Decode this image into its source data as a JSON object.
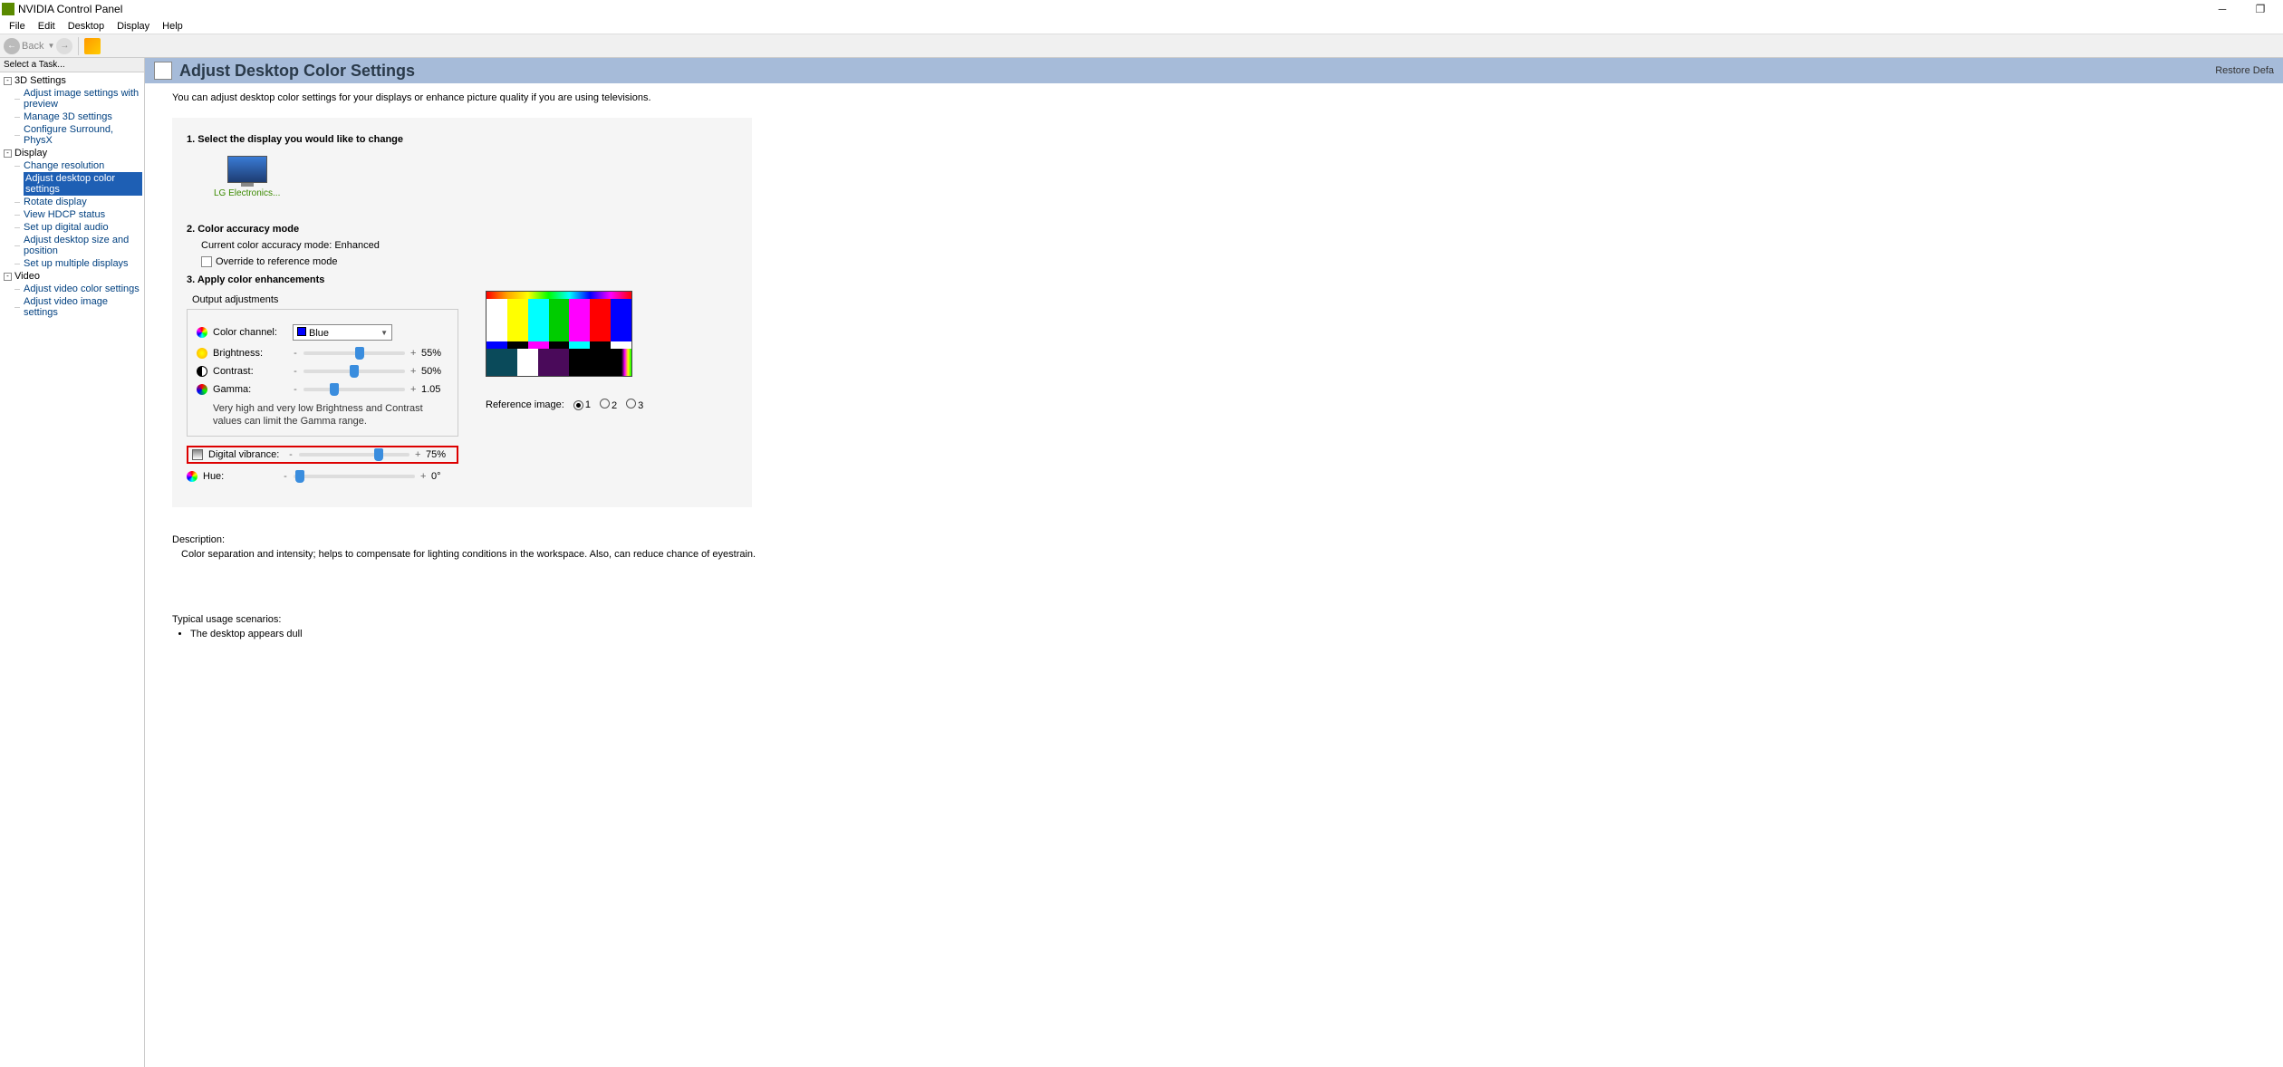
{
  "titlebar": {
    "title": "NVIDIA Control Panel"
  },
  "menubar": [
    "File",
    "Edit",
    "Desktop",
    "Display",
    "Help"
  ],
  "toolbar": {
    "back": "Back"
  },
  "sidebar": {
    "header": "Select a Task...",
    "groups": [
      {
        "label": "3D Settings",
        "items": [
          "Adjust image settings with preview",
          "Manage 3D settings",
          "Configure Surround, PhysX"
        ]
      },
      {
        "label": "Display",
        "items": [
          "Change resolution",
          "Adjust desktop color settings",
          "Rotate display",
          "View HDCP status",
          "Set up digital audio",
          "Adjust desktop size and position",
          "Set up multiple displays"
        ],
        "selected": 1
      },
      {
        "label": "Video",
        "items": [
          "Adjust video color settings",
          "Adjust video image settings"
        ]
      }
    ]
  },
  "content": {
    "title": "Adjust Desktop Color Settings",
    "restore": "Restore Defa",
    "intro": "You can adjust desktop color settings for your displays or enhance picture quality if you are using televisions.",
    "section1": "1. Select the display you would like to change",
    "display_name": "LG Electronics...",
    "section2": "2. Color accuracy mode",
    "current_mode": "Current color accuracy mode: Enhanced",
    "override": "Override to reference mode",
    "section3": "3. Apply color enhancements",
    "output_adj": "Output adjustments",
    "color_channel_label": "Color channel:",
    "color_channel_value": "Blue",
    "sliders": {
      "brightness": {
        "label": "Brightness:",
        "value": "55%",
        "pos": 55
      },
      "contrast": {
        "label": "Contrast:",
        "value": "50%",
        "pos": 50
      },
      "gamma": {
        "label": "Gamma:",
        "value": "1.05",
        "pos": 30
      },
      "digital_vibrance": {
        "label": "Digital vibrance:",
        "value": "75%",
        "pos": 72
      },
      "hue": {
        "label": "Hue:",
        "value": "0°",
        "pos": 5
      }
    },
    "gamma_note": "Very high and very low Brightness and Contrast values can limit the Gamma range.",
    "ref_label": "Reference image:",
    "ref_options": [
      "1",
      "2",
      "3"
    ],
    "desc_label": "Description:",
    "desc_text": "Color separation and intensity; helps to compensate for lighting conditions in the workspace. Also, can reduce chance of eyestrain.",
    "usage_label": "Typical usage scenarios:",
    "usage_items": [
      "The desktop appears dull"
    ]
  }
}
